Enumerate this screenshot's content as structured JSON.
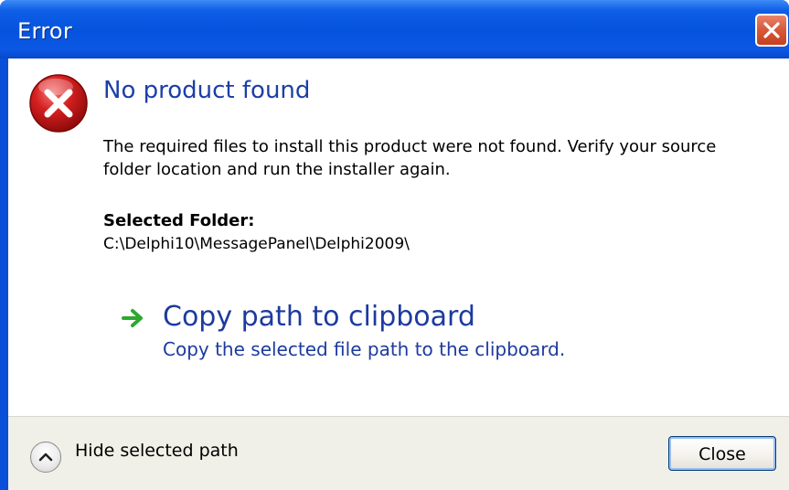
{
  "window": {
    "title": "Error"
  },
  "dialog": {
    "main_instruction": "No product found",
    "content": "The required files to install this product were not found. Verify your source\nfolder location and run the installer again.",
    "folder_label": "Selected Folder:",
    "folder_path": "C:\\Delphi10\\MessagePanel\\Delphi2009\\",
    "command_link": {
      "title": "Copy path to clipboard",
      "note": "Copy the selected file path to the clipboard.",
      "icon": "green-arrow-icon"
    },
    "icon": "error-icon"
  },
  "footer": {
    "expando_label": "Hide selected path",
    "expando_icon": "chevron-up-icon",
    "close_label": "Close"
  },
  "colors": {
    "titlebar": "#0553de",
    "instruction": "#1b3fa8",
    "command_link": "#1d3a9e",
    "footer_bg": "#f0f0e8",
    "error_red": "#d62020",
    "arrow_green": "#2ea82e"
  }
}
